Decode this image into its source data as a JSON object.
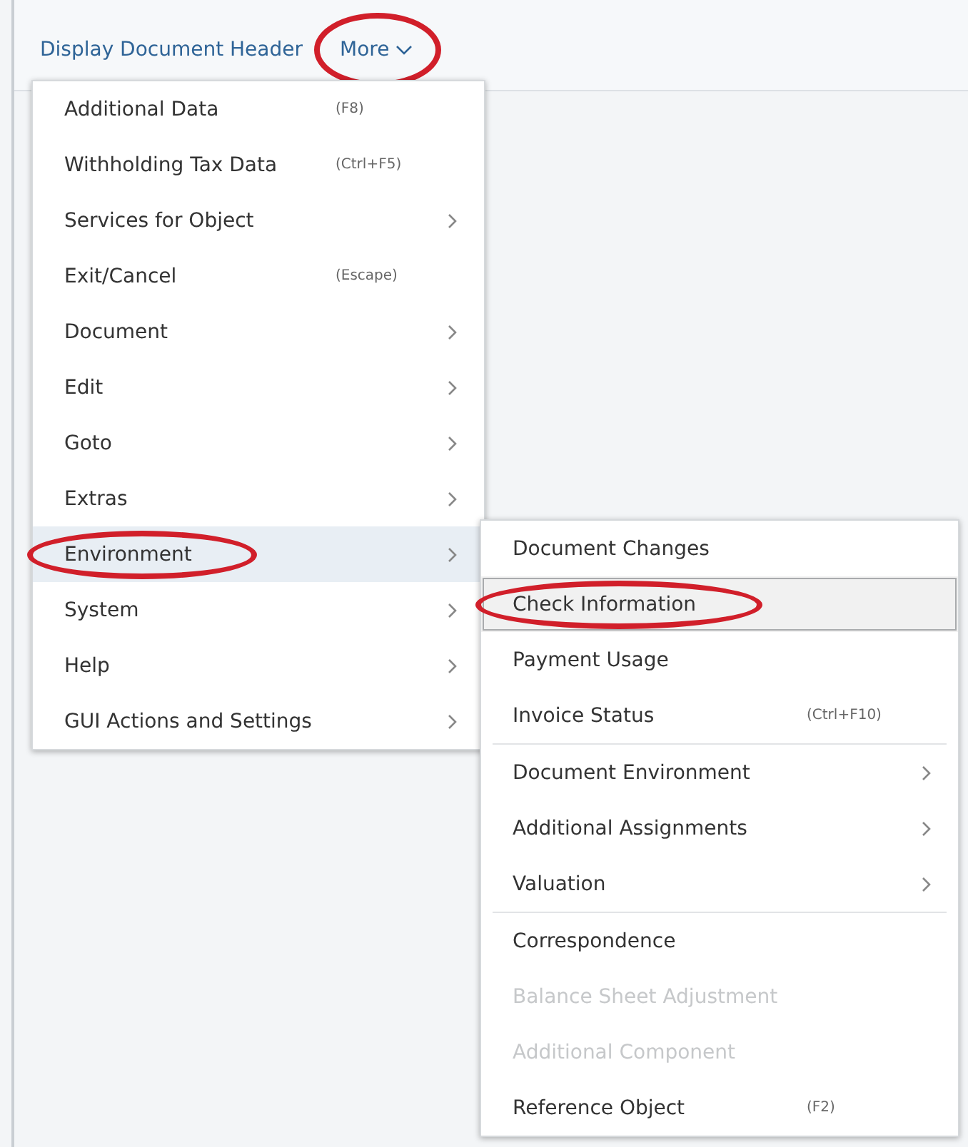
{
  "header": {
    "title": "Display Document Header",
    "more_button": {
      "label": "More",
      "circled": true
    }
  },
  "menu": {
    "items": [
      {
        "label": "Additional Data",
        "shortcut": "(F8)",
        "has_submenu": false,
        "selected": false,
        "circled": false
      },
      {
        "label": "Withholding Tax Data",
        "shortcut": "(Ctrl+F5)",
        "has_submenu": false,
        "selected": false,
        "circled": false
      },
      {
        "label": "Services for Object",
        "has_submenu": true,
        "selected": false,
        "circled": false
      },
      {
        "label": "Exit/Cancel",
        "shortcut": "(Escape)",
        "has_submenu": false,
        "selected": false,
        "circled": false
      },
      {
        "label": "Document",
        "has_submenu": true,
        "selected": false,
        "circled": false
      },
      {
        "label": "Edit",
        "has_submenu": true,
        "selected": false,
        "circled": false
      },
      {
        "label": "Goto",
        "has_submenu": true,
        "selected": false,
        "circled": false
      },
      {
        "label": "Extras",
        "has_submenu": true,
        "selected": false,
        "circled": false
      },
      {
        "label": "Environment",
        "has_submenu": true,
        "selected": true,
        "circled": true
      },
      {
        "label": "System",
        "has_submenu": true,
        "selected": false,
        "circled": false
      },
      {
        "label": "Help",
        "has_submenu": true,
        "selected": false,
        "circled": false
      },
      {
        "label": "GUI Actions and Settings",
        "has_submenu": true,
        "selected": false,
        "circled": false
      }
    ]
  },
  "submenu": {
    "groups": [
      [
        {
          "label": "Document Changes",
          "has_submenu": false,
          "selected": false,
          "disabled": false,
          "circled": false
        },
        {
          "label": "Check Information",
          "has_submenu": false,
          "selected": true,
          "disabled": false,
          "circled": true
        },
        {
          "label": "Payment Usage",
          "has_submenu": false,
          "selected": false,
          "disabled": false,
          "circled": false
        },
        {
          "label": "Invoice Status",
          "shortcut": "(Ctrl+F10)",
          "has_submenu": false,
          "selected": false,
          "disabled": false,
          "circled": false
        }
      ],
      [
        {
          "label": "Document Environment",
          "has_submenu": true,
          "selected": false,
          "disabled": false,
          "circled": false
        },
        {
          "label": "Additional Assignments",
          "has_submenu": true,
          "selected": false,
          "disabled": false,
          "circled": false
        },
        {
          "label": "Valuation",
          "has_submenu": true,
          "selected": false,
          "disabled": false,
          "circled": false
        }
      ],
      [
        {
          "label": "Correspondence",
          "has_submenu": false,
          "selected": false,
          "disabled": false,
          "circled": false
        },
        {
          "label": "Balance Sheet Adjustment",
          "has_submenu": false,
          "selected": false,
          "disabled": true,
          "circled": false
        },
        {
          "label": "Additional Component",
          "has_submenu": false,
          "selected": false,
          "disabled": true,
          "circled": false
        },
        {
          "label": "Reference Object",
          "shortcut": "(F2)",
          "has_submenu": false,
          "selected": false,
          "disabled": false,
          "circled": false
        }
      ]
    ]
  }
}
